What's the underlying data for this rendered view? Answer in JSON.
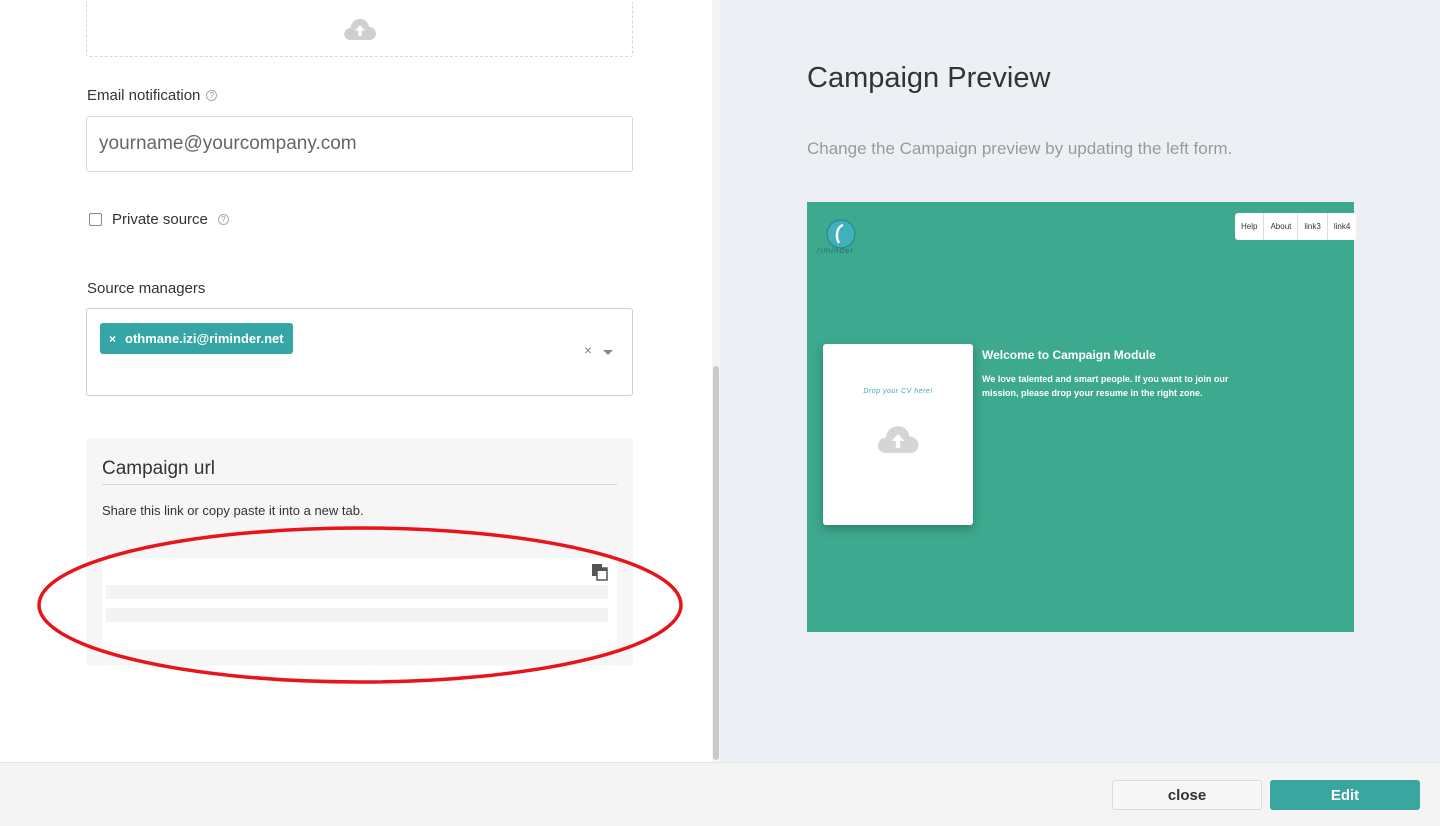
{
  "form": {
    "email_label": "Email notification",
    "email_placeholder": "yourname@yourcompany.com",
    "private_label": "Private source",
    "managers_label": "Source managers",
    "manager_tags": [
      "othmane.izi@riminder.net"
    ],
    "tag_remove": "×",
    "clear_all": "×"
  },
  "campaign_url": {
    "title": "Campaign url",
    "description": "Share this link or copy paste it into a new tab."
  },
  "preview": {
    "title": "Campaign Preview",
    "subtitle": "Change the Campaign preview by updating the left form.",
    "logo_text": "riminder",
    "nav_links": [
      "Help",
      "About",
      "link3",
      "link4"
    ],
    "drop_text": "Drop your CV here!",
    "welcome_title": "Welcome to Campaign Module",
    "welcome_text": "We love talented and smart people. If you want to join our mission, please drop your resume in the right zone.",
    "background_color": "#3da98f"
  },
  "footer": {
    "close_label": "close",
    "edit_label": "Edit",
    "edit_color": "#3aa6a0"
  },
  "annotation": {
    "color": "#e8141b"
  },
  "icons": {
    "upload": "cloud-upload-icon",
    "help": "help-icon",
    "copy": "copy-icon",
    "caret": "chevron-down-icon"
  }
}
